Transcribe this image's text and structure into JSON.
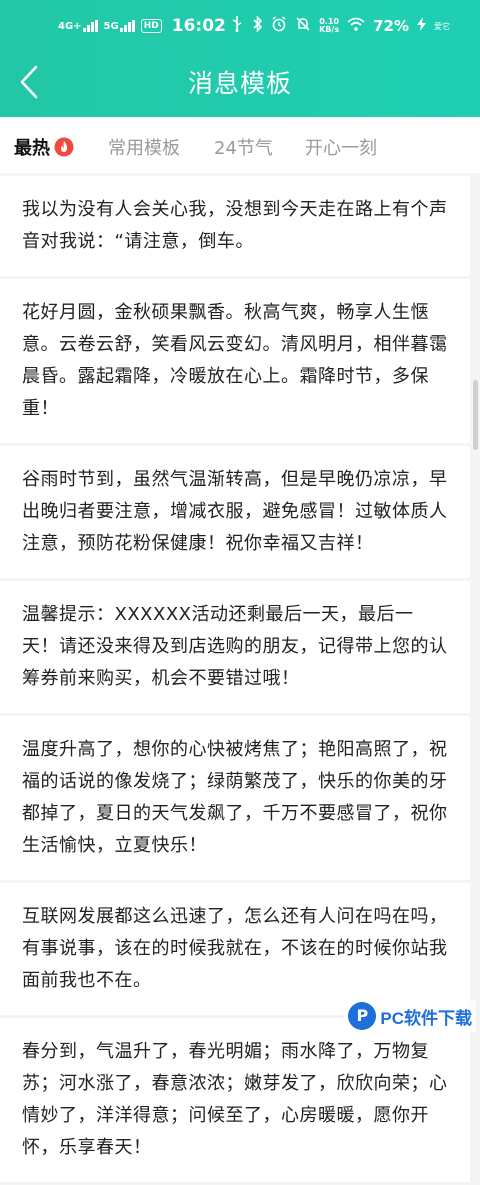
{
  "status_bar": {
    "network_1": "4G+",
    "network_2": "5G",
    "hd_badge": "HD",
    "time": "16:02",
    "net_speed_value": "0.10",
    "net_speed_unit": "KB/s",
    "battery": "72%",
    "carrier": "爱它"
  },
  "header": {
    "title": "消息模板",
    "background_color": "#22c8a5"
  },
  "tabs": [
    {
      "label": "最热",
      "active": true
    },
    {
      "label": "常用模板",
      "active": false
    },
    {
      "label": "24节气",
      "active": false
    },
    {
      "label": "开心一刻",
      "active": false
    }
  ],
  "messages": [
    "我以为没有人会关心我，没想到今天走在路上有个声音对我说：“请注意，倒车。",
    "花好月圆，金秋硕果飘香。秋高气爽，畅享人生惬意。云卷云舒，笑看风云变幻。清风明月，相伴暮霭晨昏。露起霜降，冷暖放在心上。霜降时节，多保重！",
    "谷雨时节到，虽然气温渐转高，但是早晚仍凉凉，早出晚归者要注意，增减衣服，避免感冒！过敏体质人注意，预防花粉保健康！祝你幸福又吉祥！",
    "温馨提示：XXXXXX活动还剩最后一天，最后一天！请还没来得及到店选购的朋友，记得带上您的认筹券前来购买，机会不要错过哦！",
    "温度升高了，想你的心快被烤焦了；艳阳高照了，祝福的话说的像发烧了；绿荫繁茂了，快乐的你美的牙都掉了，夏日的天气发飙了，千万不要感冒了，祝你生活愉快，立夏快乐！",
    "互联网发展都这么迅速了，怎么还有人问在吗在吗，有事说事，该在的时候我就在，不该在的时候你站我面前我也不在。",
    "春分到，气温升了，春光明媚；雨水降了，万物复苏；河水涨了，春意浓浓；嫩芽发了，欣欣向荣；心情妙了，洋洋得意；问候至了，心房暖暖，愿你开怀，乐享春天！"
  ],
  "watermark": {
    "logo": "P",
    "text": "PC软件下载"
  }
}
